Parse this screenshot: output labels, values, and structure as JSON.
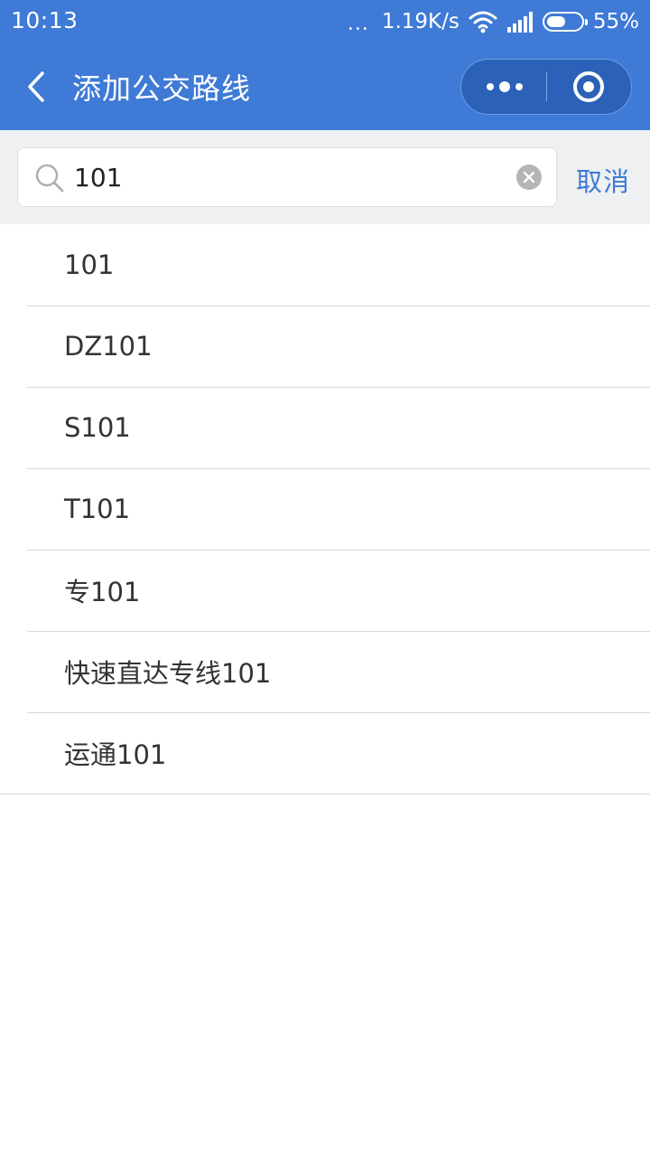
{
  "status_bar": {
    "time": "10:13",
    "dots": "...",
    "network_speed": "1.19K/s",
    "battery_percent": "55%",
    "battery_level": 0.55,
    "icons": [
      "wifi-icon",
      "signal-icon",
      "battery-icon"
    ]
  },
  "nav": {
    "title": "添加公交路线",
    "back_icon": "chevron-left-icon",
    "capsule_icons": [
      "more-dots-icon",
      "close-target-icon"
    ]
  },
  "search": {
    "value": "101",
    "placeholder": "",
    "cancel_label": "取消",
    "icons": [
      "search-icon",
      "clear-icon"
    ]
  },
  "results": [
    {
      "label": "101"
    },
    {
      "label": "DZ101"
    },
    {
      "label": "S101"
    },
    {
      "label": "T101"
    },
    {
      "label": "专101"
    },
    {
      "label": "快速直达专线101"
    },
    {
      "label": "运通101"
    }
  ],
  "colors": {
    "header_blue": "#3e7ad6",
    "search_bg": "#eff0f2",
    "divider": "#d9d9d9",
    "text": "#333333"
  }
}
